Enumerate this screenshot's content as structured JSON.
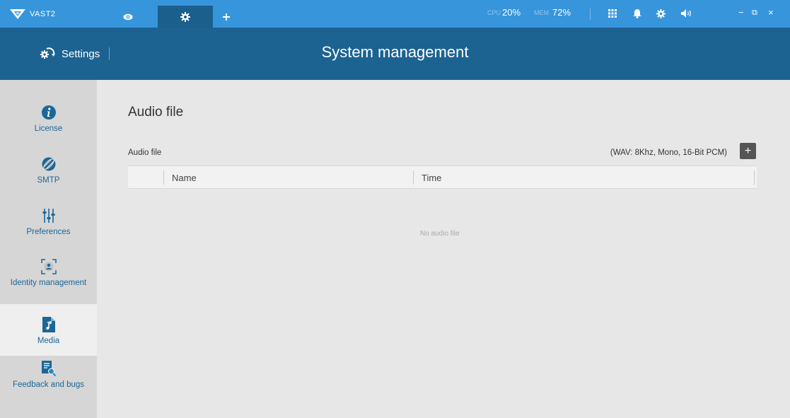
{
  "app": {
    "name": "VAST2"
  },
  "colors": {
    "topbar": "#3795dc",
    "header": "#1c6392",
    "accent": "#1d6697",
    "sidebar": "#d6d6d6",
    "content": "#e7e7e7"
  },
  "topbar": {
    "tabs": [
      {
        "icon": "eye-icon"
      },
      {
        "icon": "gear-icon",
        "active": true
      },
      {
        "icon": "plus-icon"
      }
    ],
    "cpu_label": "CPU",
    "cpu_value": "20%",
    "mem_label": "MEM",
    "mem_value": "72%",
    "icons": [
      "grid-icon",
      "bell-icon",
      "gear-icon",
      "speaker-icon"
    ],
    "window": {
      "minimize": "−",
      "restore": "⧉",
      "close": "×"
    }
  },
  "header": {
    "section": "Settings",
    "title": "System management"
  },
  "sidebar": {
    "items": [
      {
        "label": "License",
        "icon": "info-icon"
      },
      {
        "label": "SMTP",
        "icon": "globe-icon"
      },
      {
        "label": "Preferences",
        "icon": "sliders-icon"
      },
      {
        "label": "Identity management",
        "icon": "identity-icon"
      },
      {
        "label": "Media",
        "icon": "music-file-icon",
        "active": true
      },
      {
        "label": "Feedback and bugs",
        "icon": "feedback-icon"
      }
    ]
  },
  "main": {
    "title": "Audio file",
    "section_label": "Audio file",
    "format_note": "(WAV: 8Khz, Mono, 16-Bit PCM)",
    "add_label": "+",
    "columns": [
      "Name",
      "Time"
    ],
    "empty_text": "No audio file"
  }
}
